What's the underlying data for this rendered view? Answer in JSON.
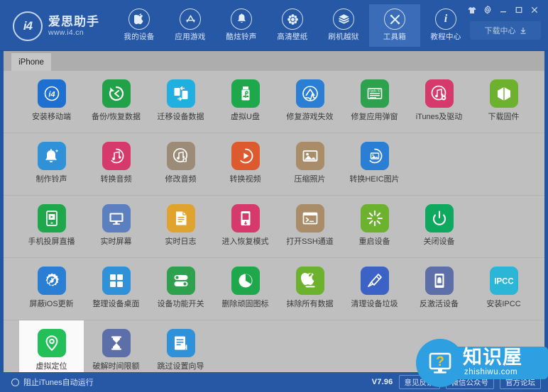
{
  "window": {
    "controls": [
      {
        "name": "skin-icon",
        "label": "皮肤"
      },
      {
        "name": "settings-gear-icon",
        "label": "设置"
      },
      {
        "name": "minimize-icon",
        "label": "最小化"
      },
      {
        "name": "maximize-icon",
        "label": "最大化"
      },
      {
        "name": "close-icon",
        "label": "关闭"
      }
    ]
  },
  "logo": {
    "mark": "i4",
    "name": "爱思助手",
    "url": "www.i4.cn"
  },
  "nav": {
    "items": [
      {
        "label": "我的设备",
        "icon": "apple-icon",
        "active": false
      },
      {
        "label": "应用游戏",
        "icon": "appstore-icon",
        "active": false
      },
      {
        "label": "酷炫铃声",
        "icon": "bell-icon",
        "active": false
      },
      {
        "label": "高清壁纸",
        "icon": "flower-icon",
        "active": false
      },
      {
        "label": "刷机越狱",
        "icon": "flash-box-icon",
        "active": false
      },
      {
        "label": "工具箱",
        "icon": "toolbox-icon",
        "active": true
      },
      {
        "label": "教程中心",
        "icon": "info-icon",
        "active": false
      }
    ],
    "download_center": "下载中心"
  },
  "tabs": [
    {
      "label": "iPhone",
      "active": true
    }
  ],
  "toolbox": {
    "rows": [
      [
        {
          "label": "安装移动端",
          "icon": "i4-app-icon",
          "color": "#1d6fd0",
          "selected": false
        },
        {
          "label": "备份/恢复数据",
          "icon": "restore-icon",
          "color": "#21a148",
          "selected": false
        },
        {
          "label": "迁移设备数据",
          "icon": "migrate-icon",
          "color": "#1fb0e0",
          "selected": false
        },
        {
          "label": "虚拟U盘",
          "icon": "usb-icon",
          "color": "#1fa84b",
          "selected": false
        },
        {
          "label": "修复游戏失效",
          "icon": "appstore-fix-icon",
          "color": "#2a7fd4",
          "selected": false
        },
        {
          "label": "修复应用弹窗",
          "icon": "appleid-icon",
          "color": "#2ea14e",
          "selected": false
        },
        {
          "label": "iTunes及驱动",
          "icon": "itunes-icon",
          "color": "#d6396b",
          "selected": false
        },
        {
          "label": "下载固件",
          "icon": "firmware-box-icon",
          "color": "#6cb22e",
          "selected": false
        }
      ],
      [
        {
          "label": "制作铃声",
          "icon": "ringtone-bell-icon",
          "color": "#2f92d8",
          "selected": false
        },
        {
          "label": "转换音频",
          "icon": "audio-convert-icon",
          "color": "#d6396b",
          "selected": false
        },
        {
          "label": "修改音频",
          "icon": "audio-edit-icon",
          "color": "#9c8b77",
          "selected": false
        },
        {
          "label": "转换视频",
          "icon": "video-convert-icon",
          "color": "#dd5a2e",
          "selected": false
        },
        {
          "label": "压缩照片",
          "icon": "photo-compress-icon",
          "color": "#a98c68",
          "selected": false
        },
        {
          "label": "转换HEIC图片",
          "icon": "heic-convert-icon",
          "color": "#2a7fd4",
          "selected": false
        },
        {
          "label": "",
          "icon": "",
          "color": "",
          "selected": false
        },
        {
          "label": "",
          "icon": "",
          "color": "",
          "selected": false
        }
      ],
      [
        {
          "label": "手机投屏直播",
          "icon": "screen-cast-icon",
          "color": "#1fa84b",
          "selected": false
        },
        {
          "label": "实时屏幕",
          "icon": "monitor-icon",
          "color": "#5c7fc0",
          "selected": false
        },
        {
          "label": "实时日志",
          "icon": "log-doc-icon",
          "color": "#e0a32e",
          "selected": false
        },
        {
          "label": "进入恢复模式",
          "icon": "recovery-phone-icon",
          "color": "#d6396b",
          "selected": false
        },
        {
          "label": "打开SSH通道",
          "icon": "terminal-icon",
          "color": "#a98c68",
          "selected": false
        },
        {
          "label": "重启设备",
          "icon": "restart-icon",
          "color": "#6cb22e",
          "selected": false
        },
        {
          "label": "关闭设备",
          "icon": "power-icon",
          "color": "#0fa85f",
          "selected": false
        },
        {
          "label": "",
          "icon": "",
          "color": "",
          "selected": false
        }
      ],
      [
        {
          "label": "屏蔽iOS更新",
          "icon": "block-update-icon",
          "color": "#2a7fd4",
          "selected": false
        },
        {
          "label": "整理设备桌面",
          "icon": "grid-desktop-icon",
          "color": "#2f92d8",
          "selected": false
        },
        {
          "label": "设备功能开关",
          "icon": "toggle-switch-icon",
          "color": "#2ea14e",
          "selected": false
        },
        {
          "label": "删除顽固图标",
          "icon": "pie-delete-icon",
          "color": "#1fa84b",
          "selected": false
        },
        {
          "label": "抹除所有数据",
          "icon": "erase-apple-icon",
          "color": "#6cb22e",
          "selected": false
        },
        {
          "label": "清理设备垃圾",
          "icon": "clean-brush-icon",
          "color": "#3b62c4",
          "selected": false
        },
        {
          "label": "反激活设备",
          "icon": "deactivate-icon",
          "color": "#5c6fa8",
          "selected": false
        },
        {
          "label": "安装IPCC",
          "icon": "ipcc-icon",
          "color": "#2bb5d6",
          "selected": false
        }
      ],
      [
        {
          "label": "虚拟定位",
          "icon": "location-pin-icon",
          "color": "#23c05a",
          "selected": true
        },
        {
          "label": "破解时间限额",
          "icon": "hourglass-icon",
          "color": "#5c6fa8",
          "selected": false
        },
        {
          "label": "跳过设置向导",
          "icon": "skip-setup-icon",
          "color": "#2f92d8",
          "selected": false
        },
        {
          "label": "",
          "icon": "",
          "color": "",
          "selected": false
        },
        {
          "label": "",
          "icon": "",
          "color": "",
          "selected": false
        },
        {
          "label": "",
          "icon": "",
          "color": "",
          "selected": false
        },
        {
          "label": "",
          "icon": "",
          "color": "",
          "selected": false
        },
        {
          "label": "",
          "icon": "",
          "color": "",
          "selected": false
        }
      ]
    ]
  },
  "statusbar": {
    "autorun_label": "阻止iTunes自动运行",
    "version": "V7.96",
    "buttons": [
      {
        "label": "意见反馈"
      },
      {
        "label": "微信公众号"
      },
      {
        "label": "官方论坛"
      }
    ]
  },
  "watermark": {
    "title": "知识屋",
    "url": "zhishiwu.com"
  },
  "colors": {
    "brand_blue": "#2658a6",
    "nav_active": "#3a6cb8",
    "content_gray": "#bfbfbf",
    "tabstrip_gray": "#adadad",
    "watermark_blue": "#2e9fe0"
  }
}
